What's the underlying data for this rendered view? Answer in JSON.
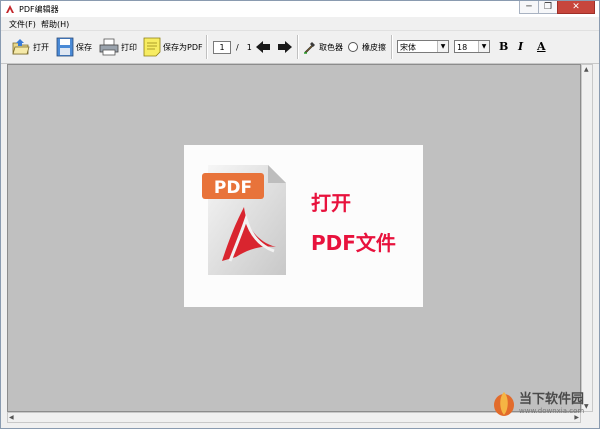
{
  "window": {
    "title": "PDF编辑器"
  },
  "window_buttons": {
    "minimize": "─",
    "restore": "❐",
    "close": "✕"
  },
  "menu": [
    {
      "label": "文件(F)"
    },
    {
      "label": "帮助(H)"
    }
  ],
  "toolbar": {
    "open_label": "打开",
    "save_label": "保存",
    "print_label": "打印",
    "save_as_pdf_label": "保存为PDF",
    "page_current": "1",
    "page_sep": "/",
    "page_total": "1",
    "color_picker_label": "取色器",
    "eraser_label": "橡皮擦",
    "font_name": "宋体",
    "font_size": "18",
    "bold_label": "B",
    "italic_label": "I",
    "font_color_label": "A"
  },
  "canvas": {
    "open_line1": "打开",
    "open_line2": "PDF文件",
    "pdf_badge": "PDF"
  },
  "watermark": {
    "name": "当下软件园",
    "url": "www.downxia.com"
  },
  "colors": {
    "accent_red": "#e8123d",
    "pdf_orange": "#e8733a",
    "canvas_bg": "#c0c0c0"
  }
}
